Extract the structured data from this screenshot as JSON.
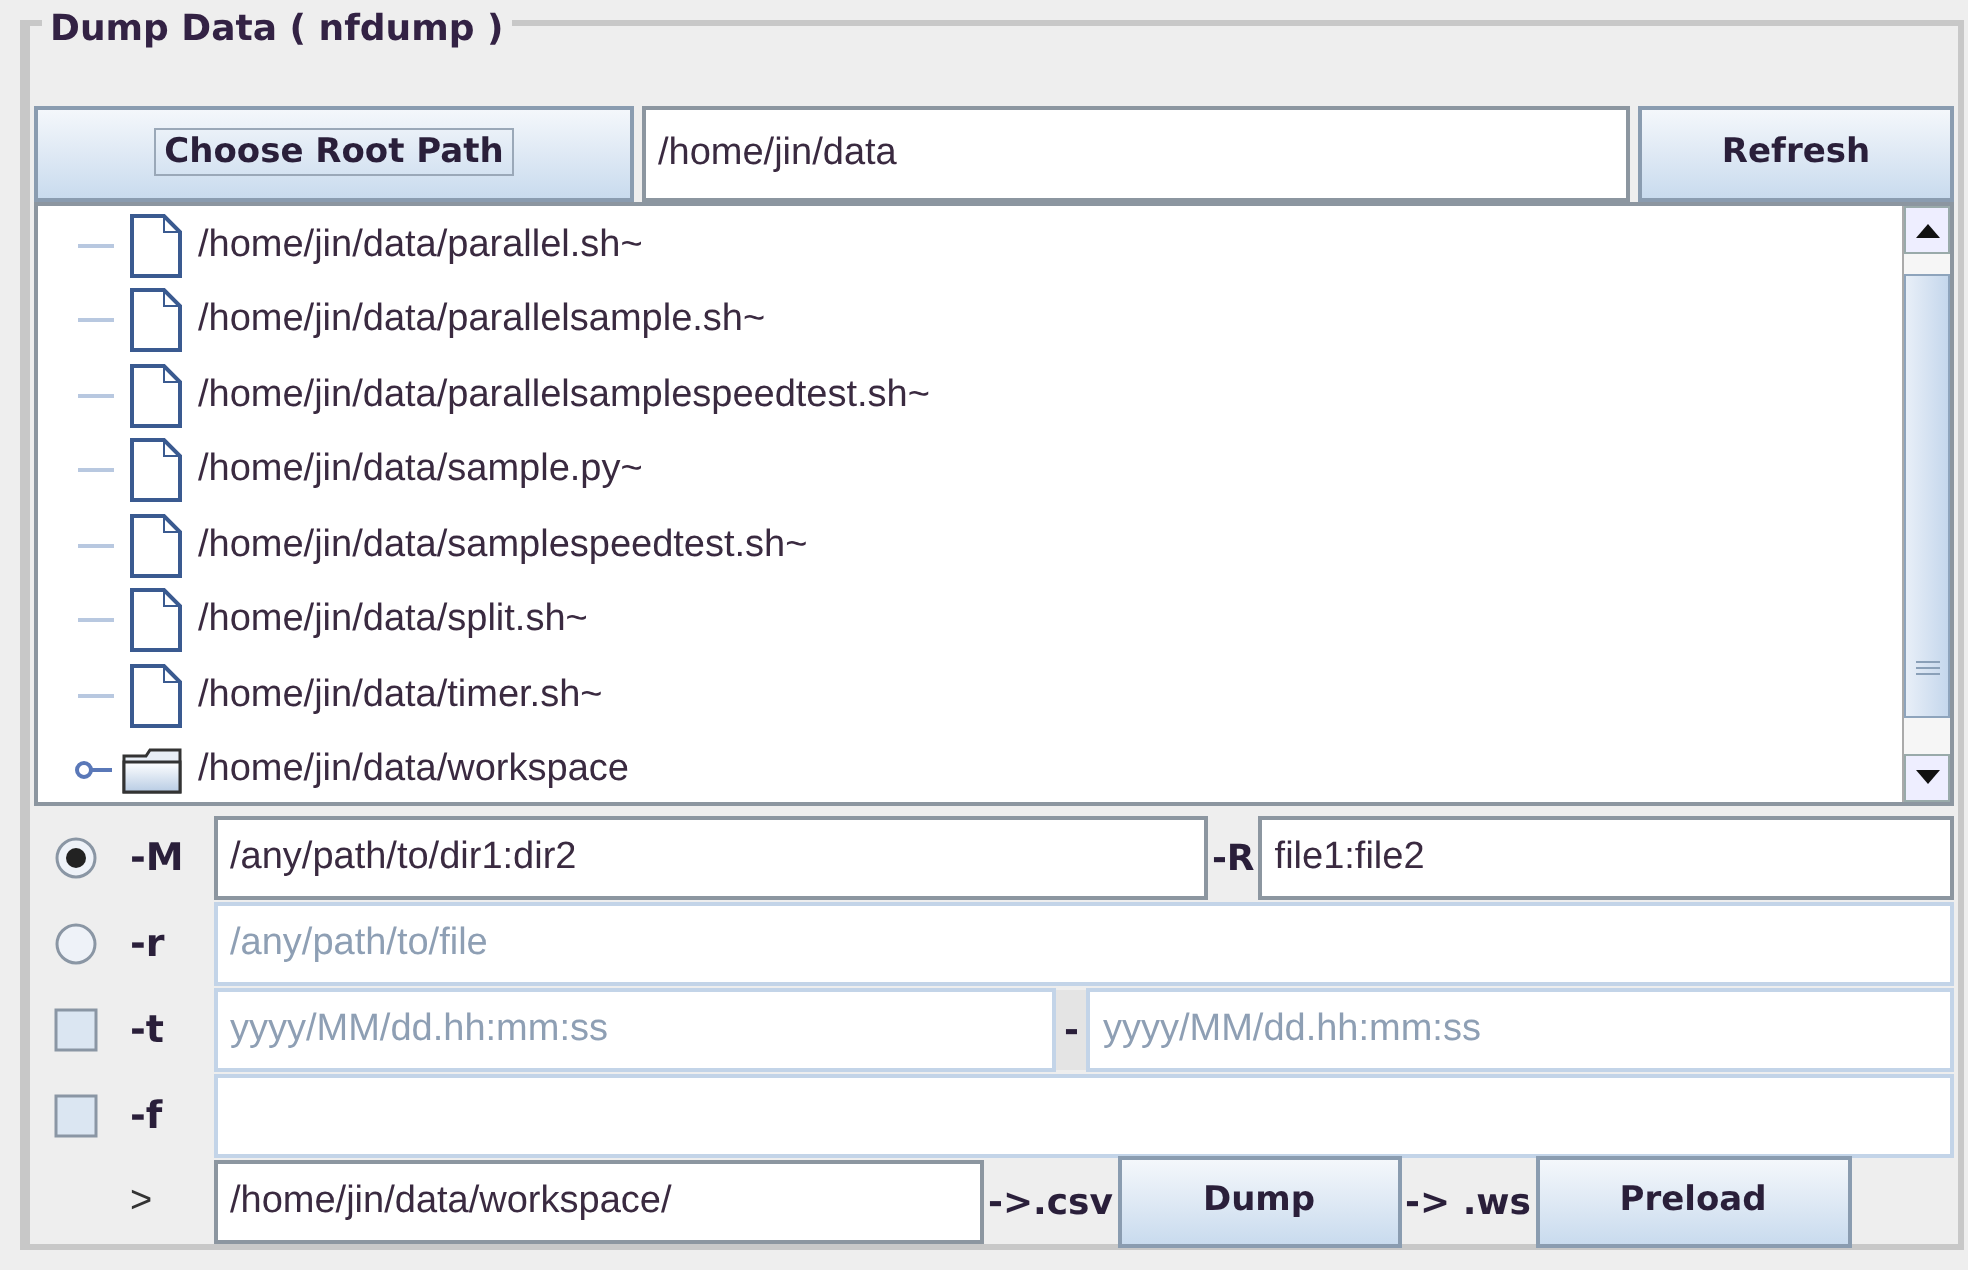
{
  "panel": {
    "title": "Dump Data ( nfdump )"
  },
  "root_bar": {
    "choose_button": "Choose Root Path",
    "path": "/home/jin/data",
    "refresh_button": "Refresh"
  },
  "tree": {
    "items": [
      {
        "label": "/home/jin/data/parallel.sh~",
        "kind": "file"
      },
      {
        "label": "/home/jin/data/parallelsample.sh~",
        "kind": "file"
      },
      {
        "label": "/home/jin/data/parallelsamplespeedtest.sh~",
        "kind": "file"
      },
      {
        "label": "/home/jin/data/sample.py~",
        "kind": "file"
      },
      {
        "label": "/home/jin/data/samplespeedtest.sh~",
        "kind": "file"
      },
      {
        "label": "/home/jin/data/split.sh~",
        "kind": "file"
      },
      {
        "label": "/home/jin/data/timer.sh~",
        "kind": "file"
      },
      {
        "label": "/home/jin/data/workspace",
        "kind": "folder",
        "expanded": false
      }
    ]
  },
  "options": [
    {
      "kind": "radio",
      "flag": "-M",
      "selected": true,
      "parts": [
        {
          "kind": "field",
          "value": "/any/path/to/dir1:dir2",
          "disabled": false
        },
        {
          "kind": "label",
          "text": "-R"
        },
        {
          "kind": "field",
          "value": "file1:file2",
          "disabled": false
        }
      ]
    },
    {
      "kind": "radio",
      "flag": "-r",
      "selected": false,
      "parts": [
        {
          "kind": "field",
          "placeholder": "/any/path/to/file",
          "disabled": true
        }
      ]
    },
    {
      "kind": "checkbox",
      "flag": "-t",
      "checked": false,
      "parts": [
        {
          "kind": "field",
          "placeholder": "yyyy/MM/dd.hh:mm:ss",
          "disabled": true
        },
        {
          "kind": "label",
          "text": "-",
          "boxed": true
        },
        {
          "kind": "field",
          "placeholder": "yyyy/MM/dd.hh:mm:ss",
          "disabled": true
        }
      ]
    },
    {
      "kind": "checkbox",
      "flag": "-f",
      "checked": false,
      "parts": [
        {
          "kind": "field",
          "disabled": true
        }
      ]
    },
    {
      "kind": "output",
      "flag": ">",
      "parts": [
        {
          "kind": "field",
          "value": "/home/jin/data/workspace/",
          "disabled": false
        },
        {
          "kind": "label",
          "text": "->.csv"
        },
        {
          "kind": "button",
          "text": "Dump"
        },
        {
          "kind": "label",
          "text": "-> .ws"
        },
        {
          "kind": "button",
          "text": "Preload"
        }
      ]
    }
  ]
}
